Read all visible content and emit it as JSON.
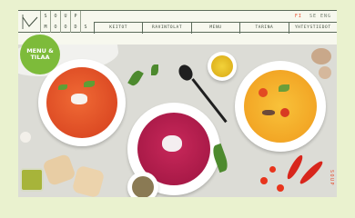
{
  "logo": {
    "letters": [
      "S",
      "O",
      "U",
      "P",
      "",
      "M",
      "O",
      "O",
      "D",
      "S"
    ]
  },
  "languages": {
    "active": "FI",
    "others": "SE  ENG"
  },
  "nav": [
    "KEITOT",
    "RAVINTOLAT",
    "MENU",
    "TARINA",
    "YHTEYSTIEDOT"
  ],
  "badge": {
    "line1": "MENU &",
    "line2": "TILAA"
  },
  "side_word": "SOUP",
  "colors": {
    "accent": "#e64b2a",
    "badge": "#7dbb3a",
    "background": "#eaf2cf"
  }
}
